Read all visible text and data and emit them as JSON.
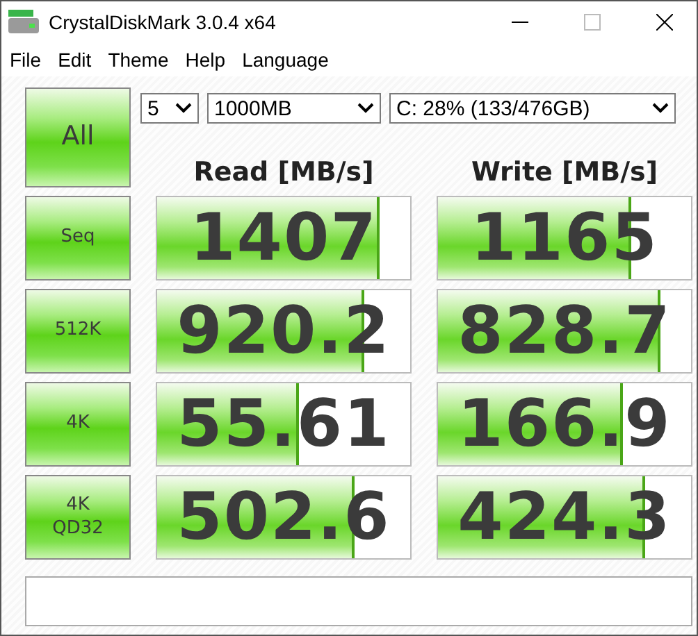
{
  "window": {
    "title": "CrystalDiskMark 3.0.4 x64"
  },
  "menu": [
    "File",
    "Edit",
    "Theme",
    "Help",
    "Language"
  ],
  "all_button": "All",
  "selects": [
    {
      "value": "5"
    },
    {
      "value": "1000MB"
    },
    {
      "value": "C: 28% (133/476GB)"
    }
  ],
  "columns": [
    "Read [MB/s]",
    "Write [MB/s]"
  ],
  "rows": [
    {
      "label": "Seq",
      "read": {
        "value": "1407",
        "level": 0.87
      },
      "write": {
        "value": "1165",
        "level": 0.75
      }
    },
    {
      "label": "512K",
      "read": {
        "value": "920.2",
        "level": 0.81
      },
      "write": {
        "value": "828.7",
        "level": 0.87
      }
    },
    {
      "label": "4K",
      "read": {
        "value": "55.61",
        "level": 0.55
      },
      "write": {
        "value": "166.9",
        "level": 0.72
      }
    },
    {
      "label": "4K\nQD32",
      "read": {
        "value": "502.6",
        "level": 0.77
      },
      "write": {
        "value": "424.3",
        "level": 0.81
      }
    }
  ]
}
